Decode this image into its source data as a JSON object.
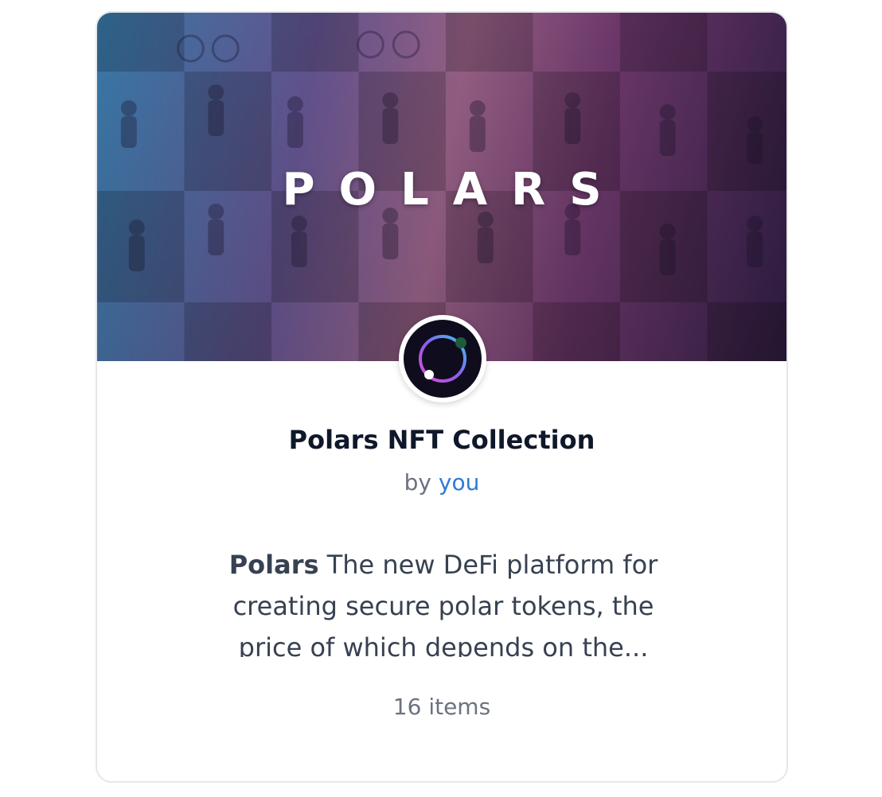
{
  "collection": {
    "banner_word": "POLARS",
    "title": "Polars NFT Collection",
    "by_prefix": "by",
    "author": "you",
    "description_brand": "Polars",
    "description_text": " The new DeFi platform for creating secure polar tokens, the price of which depends on the...",
    "items_count": "16 items"
  },
  "icons": {
    "avatar": "polars-ring-logo-icon"
  },
  "colors": {
    "author_link": "#2e7bd6",
    "title": "#0f172a",
    "muted": "#6b7280",
    "border": "#e5e7eb"
  }
}
